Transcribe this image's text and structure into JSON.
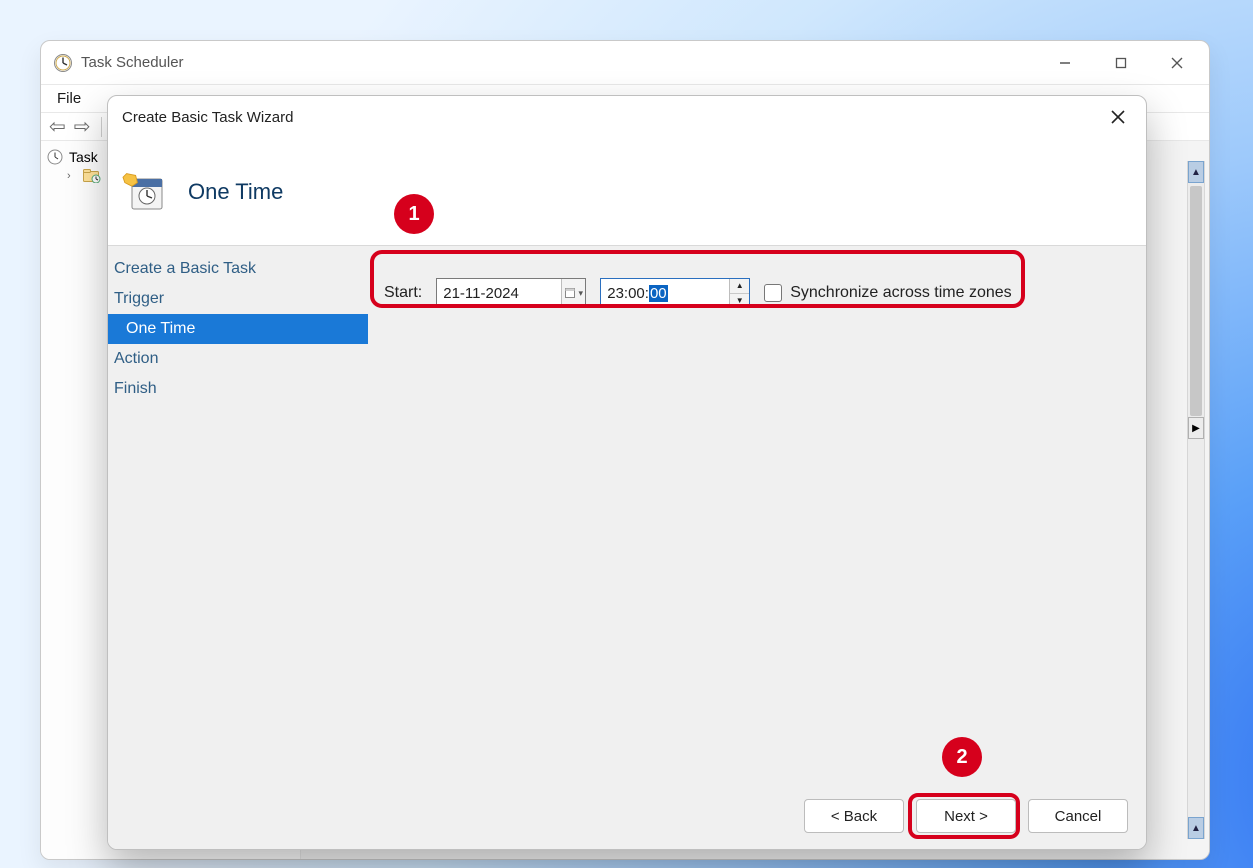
{
  "main_window": {
    "title": "Task Scheduler",
    "menu": {
      "file": "File"
    },
    "tree": {
      "root": "Task Scheduler",
      "root_label_short": "Task"
    }
  },
  "wizard": {
    "title": "Create Basic Task Wizard",
    "header_title": "One Time",
    "steps": {
      "create": "Create a Basic Task",
      "trigger": "Trigger",
      "onetime": "One Time",
      "action": "Action",
      "finish": "Finish"
    },
    "content": {
      "start_label": "Start:",
      "date_value": "21-11-2024",
      "time_prefix": "23:00:",
      "time_selected": "00",
      "sync_label": "Synchronize across time zones"
    },
    "buttons": {
      "back": "< Back",
      "next": "Next >",
      "cancel": "Cancel"
    }
  },
  "annotations": {
    "badge1": "1",
    "badge2": "2"
  }
}
